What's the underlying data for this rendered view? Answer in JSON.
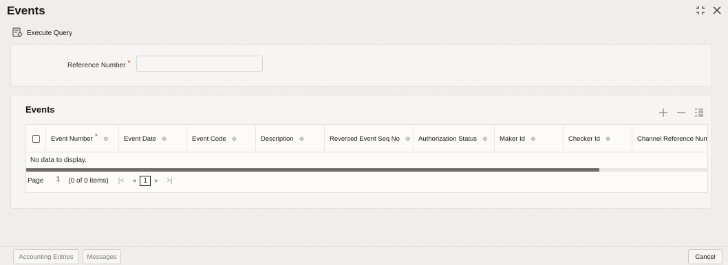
{
  "window": {
    "title": "Events"
  },
  "toolbar": {
    "execute_query_label": "Execute Query"
  },
  "search": {
    "reference_number_label": "Reference Number",
    "required_mark": "*",
    "reference_number_value": ""
  },
  "events_section": {
    "title": "Events",
    "columns": [
      "Event Number",
      "Event Date",
      "Event Code",
      "Description",
      "Reversed Event Seq No",
      "Authorization Status",
      "Maker Id",
      "Checker Id",
      "Channel Reference Numb"
    ],
    "event_number_required": "*",
    "sort_glyph": "≎",
    "no_data": "No data to display.",
    "pager": {
      "page_label": "Page",
      "page_value": "1",
      "items_text": "(0 of 0 items)",
      "first": "|<",
      "prev": "◂",
      "current": "1",
      "next": "▸",
      "last": ">|"
    },
    "scroll_position": 0.84
  },
  "footer": {
    "accounting_entries_label": "Accounting Entries",
    "messages_label": "Messages",
    "cancel_label": "Cancel"
  },
  "colors": {
    "required": "#c74634",
    "background": "#f1efec",
    "panel": "#f6f5f3"
  },
  "icons": {
    "execute_query": "execute-query-icon",
    "minimize": "minimize-icon",
    "close": "close-icon",
    "add": "add-icon",
    "remove": "remove-icon",
    "columns": "columns-icon"
  }
}
